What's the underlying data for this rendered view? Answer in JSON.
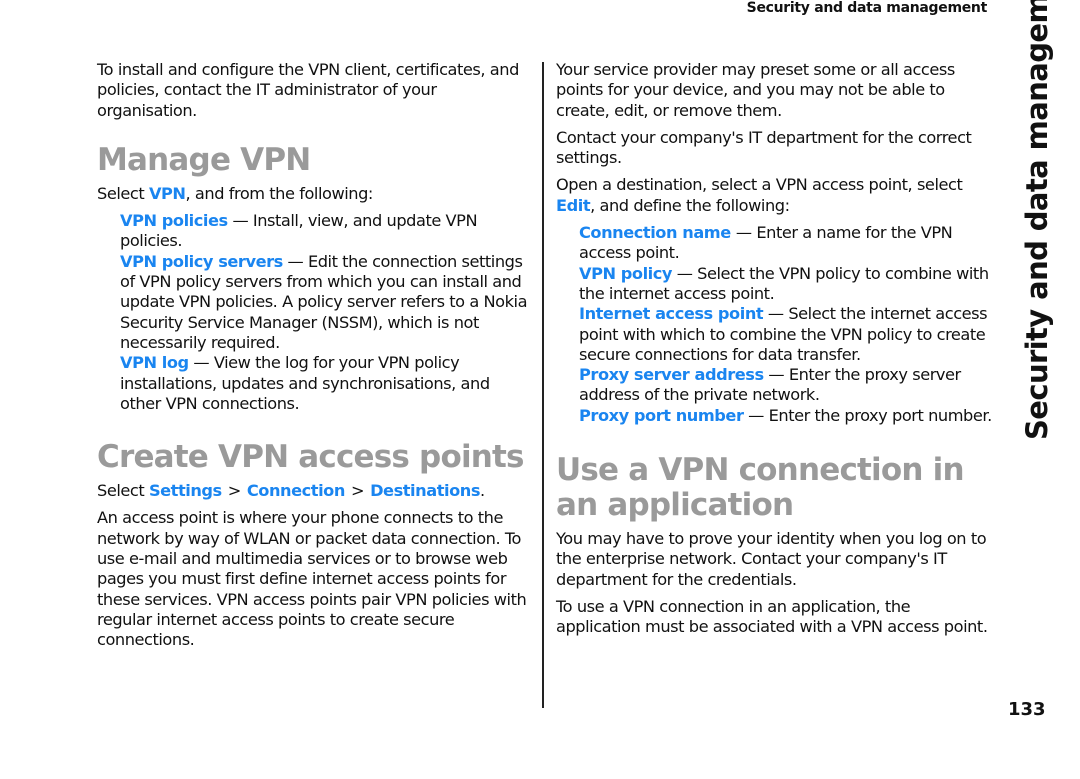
{
  "running_head": "Security and data management",
  "side_tab": "Security and data management",
  "page_number": "133",
  "colors": {
    "link": "#1a85f0",
    "heading": "#9a9a9a",
    "text": "#111111"
  },
  "left": {
    "intro": "To install and configure the VPN client, certificates, and policies, contact the IT administrator of your organisation.",
    "manage_vpn": {
      "title": "Manage VPN",
      "select_pre": "Select ",
      "select_link": "VPN",
      "select_post": ", and from the following:",
      "items": [
        {
          "term": "VPN policies",
          "desc": " — Install, view, and update VPN policies."
        },
        {
          "term": "VPN policy servers",
          "desc": " — Edit the connection settings of VPN policy servers from which you can install and update VPN policies. A policy server refers to a Nokia Security Service Manager (NSSM), which is not necessarily required."
        },
        {
          "term": "VPN log",
          "desc": " — View the log for your VPN policy installations, updates and synchronisations, and other VPN connections."
        }
      ]
    },
    "create_vpn": {
      "title": "Create VPN access points",
      "select_pre": "Select ",
      "path": [
        "Settings",
        "Connection",
        "Destinations"
      ],
      "path_sep": ">",
      "path_end": ".",
      "body": "An access point is where your phone connects to the network by way of WLAN or packet data connection. To use e-mail and multimedia services or to browse web pages you must first define internet access points for these services. VPN access points pair VPN policies with regular internet access points to create secure connections."
    }
  },
  "right": {
    "p1": "Your service provider may preset some or all access points for your device, and you may not be able to create, edit, or remove them.",
    "p2": "Contact your company's IT department for the correct settings.",
    "p3_pre": "Open a destination, select a VPN access point, select ",
    "p3_link": "Edit",
    "p3_post": ", and define the following:",
    "items": [
      {
        "term": "Connection name ",
        "desc": " — Enter a name for the VPN access point."
      },
      {
        "term": "VPN policy",
        "desc": " — Select the VPN policy to combine with the internet access point."
      },
      {
        "term": "Internet access point",
        "desc": " — Select the internet access point with which to combine the VPN policy to create secure connections for data transfer."
      },
      {
        "term": "Proxy server address",
        "desc": " — Enter the proxy server address of the private network."
      },
      {
        "term": "Proxy port number",
        "desc": " — Enter the proxy port number."
      }
    ],
    "use_vpn": {
      "title": "Use a VPN connection in an application",
      "p1": "You may have to prove your identity when you log on to the enterprise network. Contact your company's IT department for the credentials.",
      "p2": "To use a VPN connection in an application, the application must be associated with a VPN access point."
    }
  }
}
